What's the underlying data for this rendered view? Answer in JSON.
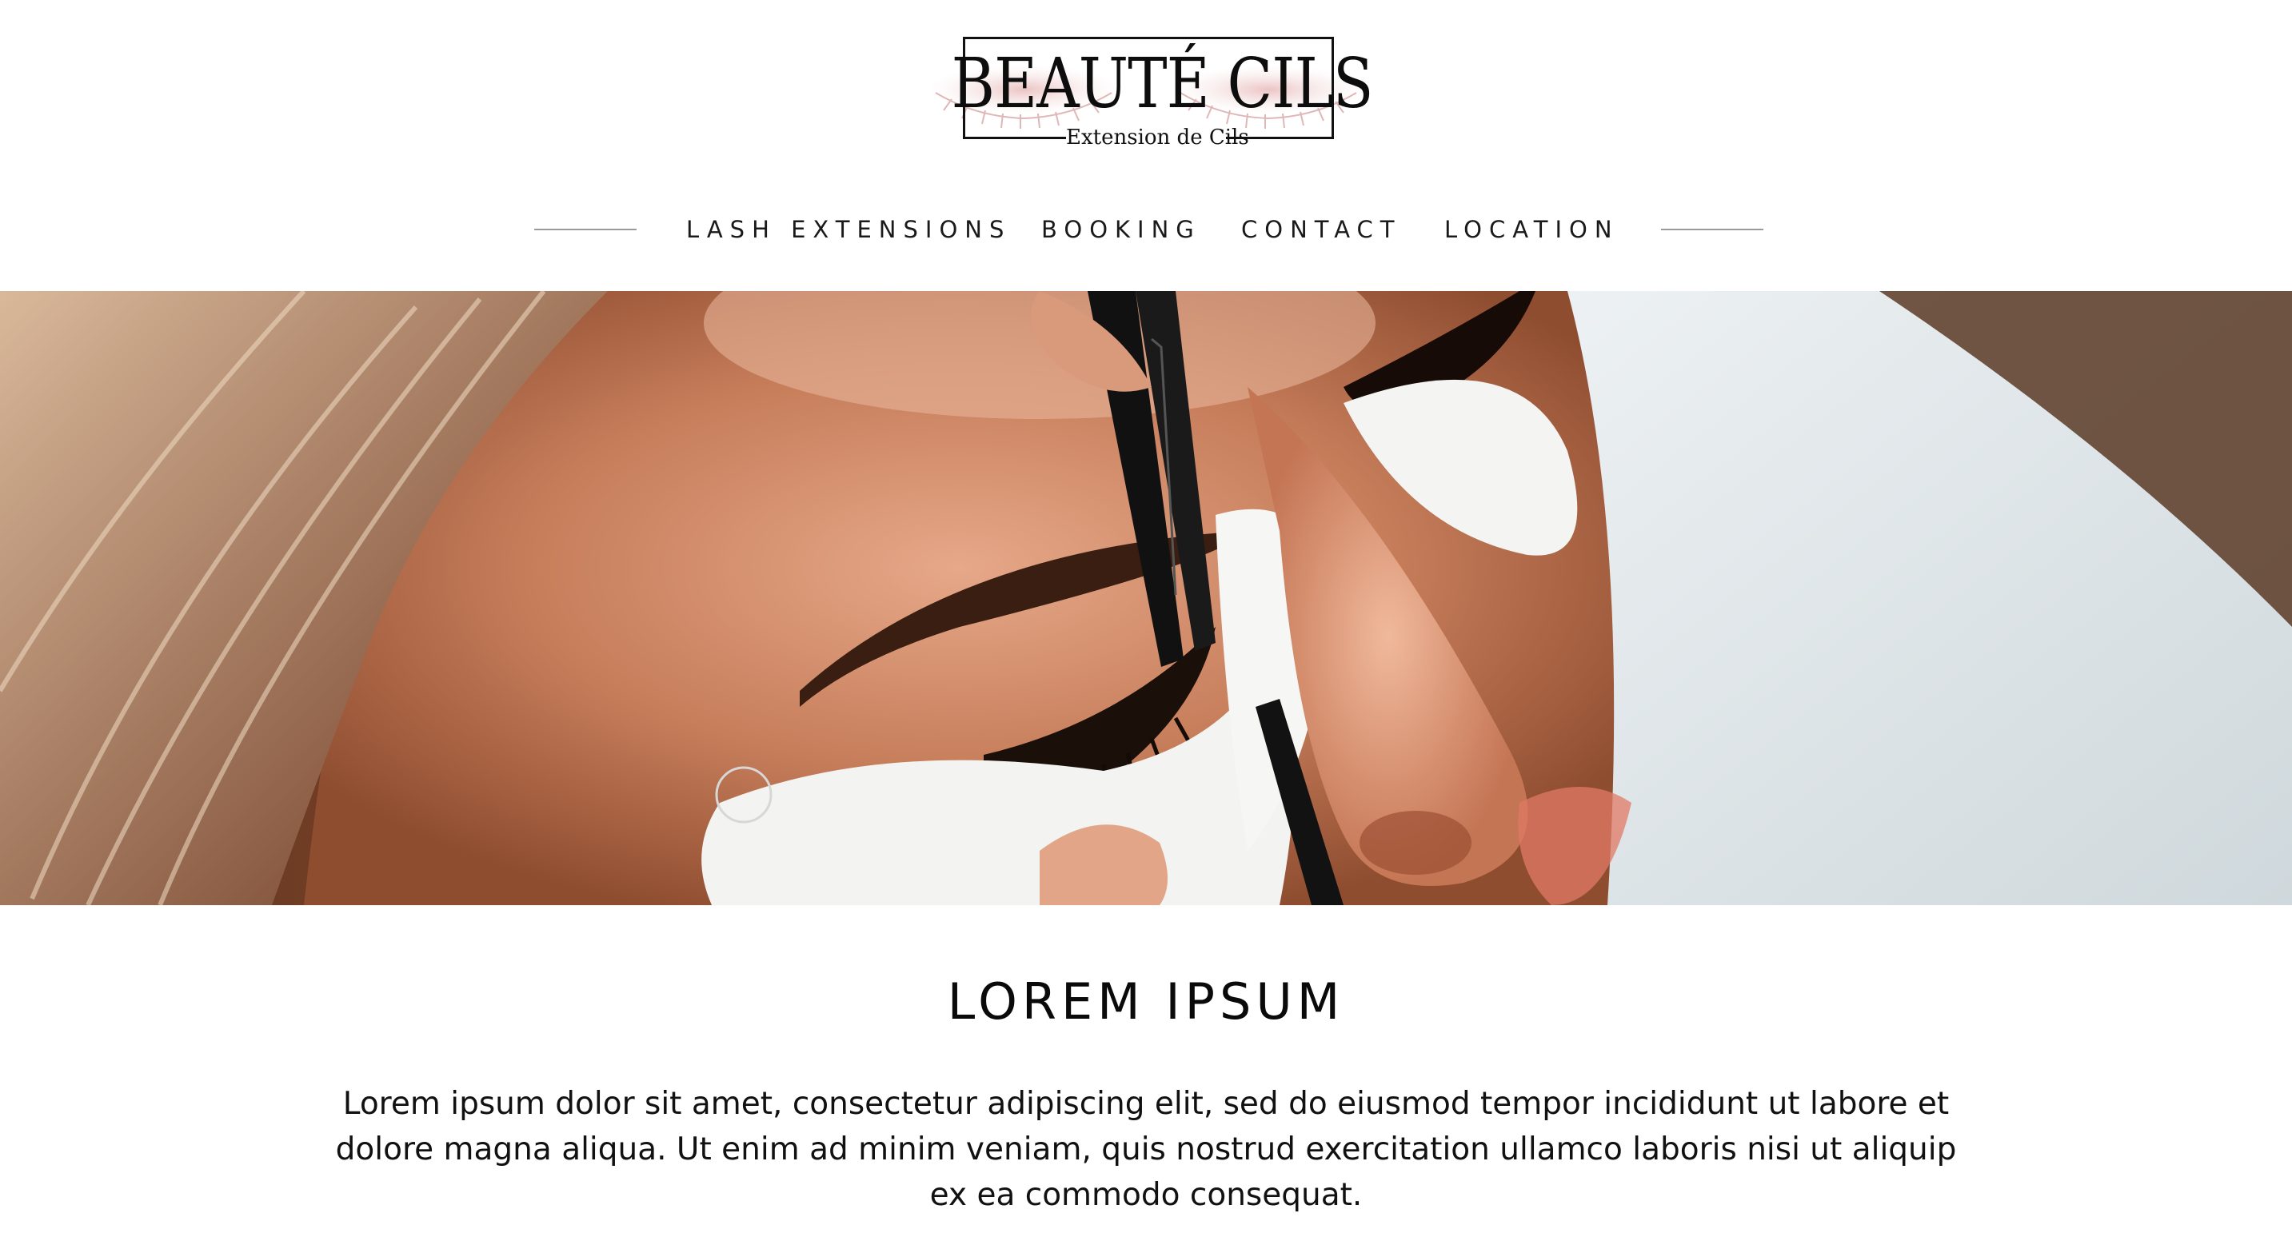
{
  "brand": {
    "title": "BEAUTÉ CILS",
    "subtitle": "Extension de Cils",
    "accent_color": "#e8c4c4"
  },
  "nav": {
    "items": [
      {
        "label": "LASH EXTENSIONS"
      },
      {
        "label": "BOOKING"
      },
      {
        "label": "CONTACT"
      },
      {
        "label": "LOCATION"
      }
    ]
  },
  "hero": {
    "image": "photo-eyelash-extension-application"
  },
  "content": {
    "heading": "LOREM IPSUM",
    "paragraph": "Lorem ipsum dolor sit amet, consectetur adipiscing elit, sed do eiusmod tempor incididunt ut labore et dolore magna aliqua. Ut enim ad minim veniam, quis nostrud exercitation ullamco laboris nisi ut aliquip ex ea commodo consequat."
  }
}
